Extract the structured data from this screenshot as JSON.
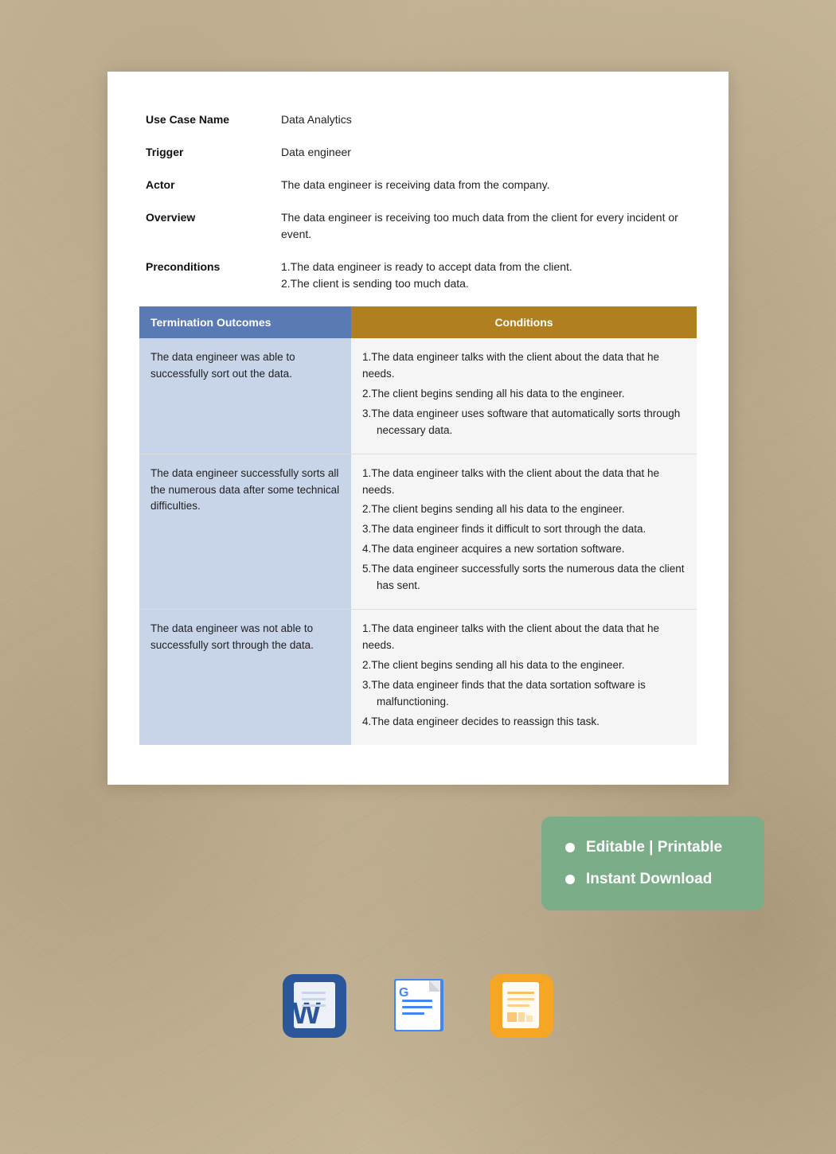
{
  "page": {
    "background_color": "#c8b89a"
  },
  "card": {
    "info_rows": [
      {
        "label": "Use Case Name",
        "value": "Data Analytics"
      },
      {
        "label": "Trigger",
        "value": "Data engineer"
      },
      {
        "label": "Actor",
        "value": "The data engineer is receiving data from the company."
      },
      {
        "label": "Overview",
        "value": "The data engineer is receiving too much data from the client for every incident or event."
      },
      {
        "label": "Preconditions",
        "value": ""
      }
    ],
    "preconditions": [
      "1.The data engineer is ready to accept data from the client.",
      "2.The client is sending too much data."
    ],
    "table": {
      "header": {
        "col1": "Termination Outcomes",
        "col2": "Conditions"
      },
      "rows": [
        {
          "outcome": "The data engineer was able to successfully sort out the data.",
          "conditions": [
            {
              "num": "1.",
              "text": "The data engineer talks with the client about the data that he needs."
            },
            {
              "num": "2.",
              "text": "The client begins sending all his data to the engineer."
            },
            {
              "num": "3.",
              "text": "The data engineer uses software that automatically sorts through",
              "indent": "necessary data."
            }
          ]
        },
        {
          "outcome": "The data engineer successfully sorts all the numerous data after some technical difficulties.",
          "conditions": [
            {
              "num": "1.",
              "text": "The data engineer talks with the client about the data that he needs."
            },
            {
              "num": "2.",
              "text": "The client begins sending all his data to the engineer."
            },
            {
              "num": "3.",
              "text": "The data engineer finds it difficult to sort through the data."
            },
            {
              "num": "4.",
              "text": "The data engineer acquires a new sortation software."
            },
            {
              "num": "5.",
              "text": "The data engineer successfully sorts the numerous data the client",
              "indent": "has sent."
            }
          ]
        },
        {
          "outcome": "The data engineer was not able to successfully sort through the data.",
          "conditions": [
            {
              "num": "1.",
              "text": "The data engineer talks with the client about the data that he needs."
            },
            {
              "num": "2.",
              "text": "The client begins sending all his data to the engineer."
            },
            {
              "num": "3.",
              "text": "The data engineer finds that the data sortation software is",
              "indent": "malfunctioning."
            },
            {
              "num": "4.",
              "text": "The data engineer decides to reassign this task."
            }
          ]
        }
      ]
    }
  },
  "badge": {
    "features": [
      "Editable | Printable",
      "Instant Download"
    ]
  },
  "app_icons": [
    {
      "name": "Microsoft Word",
      "type": "word"
    },
    {
      "name": "Google Docs",
      "type": "gdocs"
    },
    {
      "name": "Apple Pages",
      "type": "pages"
    }
  ]
}
